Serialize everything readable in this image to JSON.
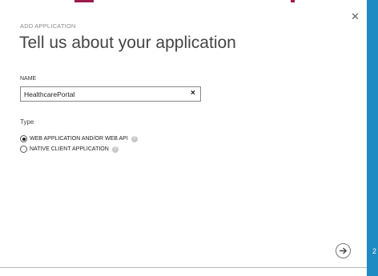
{
  "dialog": {
    "eyebrow": "ADD APPLICATION",
    "title": "Tell us about your application",
    "close_icon": "close-icon",
    "name": {
      "label": "NAME",
      "value": "HealthcarePortal",
      "clear_glyph": "×"
    },
    "type": {
      "label": "Type",
      "options": [
        {
          "label": "WEB APPLICATION AND/OR WEB API",
          "selected": true,
          "help_icon": "help-icon"
        },
        {
          "label": "NATIVE CLIENT APPLICATION",
          "selected": false,
          "help_icon": "help-icon"
        }
      ]
    },
    "next_icon": "arrow-right-icon"
  },
  "side_strip": {
    "text": "2",
    "color": "#1e8bc3"
  },
  "colors": {
    "accent": "#9c1c4e",
    "strip": "#1e8bc3"
  }
}
